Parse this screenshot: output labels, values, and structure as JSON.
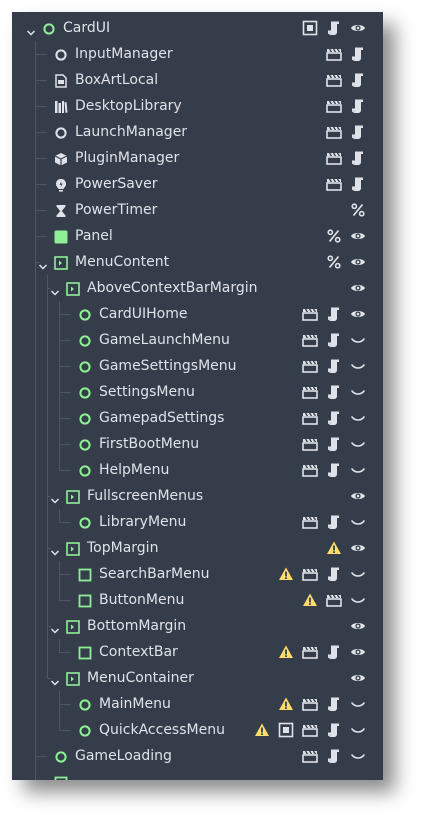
{
  "colors": {
    "panel_bg": "#363d4a",
    "text": "#dfe2e8",
    "node_green": "#8eef97",
    "warning": "#ffdd66",
    "guide": "#4d5566"
  },
  "tree": [
    {
      "label": "CardUI",
      "depth": 0,
      "expanded": true,
      "icon": "control-circle-icon",
      "actions": [
        "script-icon-unique",
        "script-icon",
        "visibility-eye-icon"
      ]
    },
    {
      "label": "InputManager",
      "depth": 1,
      "icon": "node-circle-icon",
      "actions": [
        "clapperboard-icon",
        "script-icon"
      ]
    },
    {
      "label": "BoxArtLocal",
      "depth": 1,
      "icon": "resource-box-icon",
      "actions": [
        "clapperboard-icon",
        "script-icon"
      ]
    },
    {
      "label": "DesktopLibrary",
      "depth": 1,
      "icon": "library-icon",
      "actions": [
        "clapperboard-icon",
        "script-icon"
      ]
    },
    {
      "label": "LaunchManager",
      "depth": 1,
      "icon": "node-circle-icon",
      "actions": [
        "clapperboard-icon",
        "script-icon"
      ]
    },
    {
      "label": "PluginManager",
      "depth": 1,
      "icon": "package-icon",
      "actions": [
        "clapperboard-icon",
        "script-icon"
      ]
    },
    {
      "label": "PowerSaver",
      "depth": 1,
      "icon": "power-saver-icon",
      "actions": [
        "clapperboard-icon",
        "script-icon"
      ]
    },
    {
      "label": "PowerTimer",
      "depth": 1,
      "icon": "hourglass-icon",
      "actions": [
        "percent-icon"
      ]
    },
    {
      "label": "Panel",
      "depth": 1,
      "icon": "panel-icon",
      "actions": [
        "percent-icon",
        "visibility-eye-icon"
      ]
    },
    {
      "label": "MenuContent",
      "depth": 1,
      "expanded": true,
      "icon": "margin-container-icon",
      "actions": [
        "percent-icon",
        "visibility-eye-icon"
      ]
    },
    {
      "label": "AboveContextBarMargin",
      "depth": 2,
      "expanded": true,
      "icon": "margin-container-icon",
      "actions": [
        "visibility-eye-icon"
      ]
    },
    {
      "label": "CardUIHome",
      "depth": 3,
      "icon": "control-circle-icon",
      "actions": [
        "clapperboard-icon",
        "script-icon",
        "visibility-eye-icon"
      ]
    },
    {
      "label": "GameLaunchMenu",
      "depth": 3,
      "icon": "control-circle-icon",
      "actions": [
        "clapperboard-icon",
        "script-icon",
        "hidden-eye-icon"
      ]
    },
    {
      "label": "GameSettingsMenu",
      "depth": 3,
      "icon": "control-circle-icon",
      "actions": [
        "clapperboard-icon",
        "script-icon",
        "hidden-eye-icon"
      ]
    },
    {
      "label": "SettingsMenu",
      "depth": 3,
      "icon": "control-circle-icon",
      "actions": [
        "clapperboard-icon",
        "script-icon",
        "hidden-eye-icon"
      ]
    },
    {
      "label": "GamepadSettings",
      "depth": 3,
      "icon": "control-circle-icon",
      "actions": [
        "clapperboard-icon",
        "script-icon",
        "hidden-eye-icon"
      ]
    },
    {
      "label": "FirstBootMenu",
      "depth": 3,
      "icon": "control-circle-icon",
      "actions": [
        "clapperboard-icon",
        "script-icon",
        "hidden-eye-icon"
      ]
    },
    {
      "label": "HelpMenu",
      "depth": 3,
      "icon": "control-circle-icon",
      "actions": [
        "clapperboard-icon",
        "script-icon",
        "hidden-eye-icon"
      ]
    },
    {
      "label": "FullscreenMenus",
      "depth": 2,
      "expanded": true,
      "icon": "margin-container-icon",
      "actions": [
        "visibility-eye-icon"
      ]
    },
    {
      "label": "LibraryMenu",
      "depth": 3,
      "icon": "control-circle-icon",
      "actions": [
        "clapperboard-icon",
        "script-icon",
        "hidden-eye-icon"
      ]
    },
    {
      "label": "TopMargin",
      "depth": 2,
      "expanded": true,
      "icon": "margin-container-icon",
      "actions": [
        "warning-icon",
        "visibility-eye-icon"
      ]
    },
    {
      "label": "SearchBarMenu",
      "depth": 3,
      "icon": "control-square-icon",
      "actions": [
        "warning-icon",
        "clapperboard-icon",
        "script-icon",
        "hidden-eye-icon"
      ]
    },
    {
      "label": "ButtonMenu",
      "depth": 3,
      "icon": "control-square-icon",
      "actions": [
        "warning-icon",
        "clapperboard-icon",
        "hidden-eye-icon"
      ]
    },
    {
      "label": "BottomMargin",
      "depth": 2,
      "expanded": true,
      "icon": "margin-container-icon",
      "actions": [
        "visibility-eye-icon"
      ]
    },
    {
      "label": "ContextBar",
      "depth": 3,
      "icon": "control-square-icon",
      "actions": [
        "warning-icon",
        "clapperboard-icon",
        "script-icon",
        "visibility-eye-icon"
      ]
    },
    {
      "label": "MenuContainer",
      "depth": 2,
      "expanded": true,
      "icon": "margin-container-icon",
      "actions": [
        "visibility-eye-icon"
      ]
    },
    {
      "label": "MainMenu",
      "depth": 3,
      "icon": "control-circle-icon",
      "actions": [
        "warning-icon",
        "clapperboard-icon",
        "script-icon",
        "hidden-eye-icon"
      ]
    },
    {
      "label": "QuickAccessMenu",
      "depth": 3,
      "icon": "control-circle-icon",
      "actions": [
        "warning-icon",
        "script-icon-unique",
        "clapperboard-icon",
        "script-icon",
        "hidden-eye-icon"
      ]
    },
    {
      "label": "GameLoading",
      "depth": 1,
      "icon": "control-circle-icon",
      "actions": [
        "clapperboard-icon",
        "script-icon",
        "hidden-eye-icon"
      ]
    },
    {
      "label": "",
      "depth": 1,
      "icon": "control-square-icon",
      "actions": []
    }
  ]
}
